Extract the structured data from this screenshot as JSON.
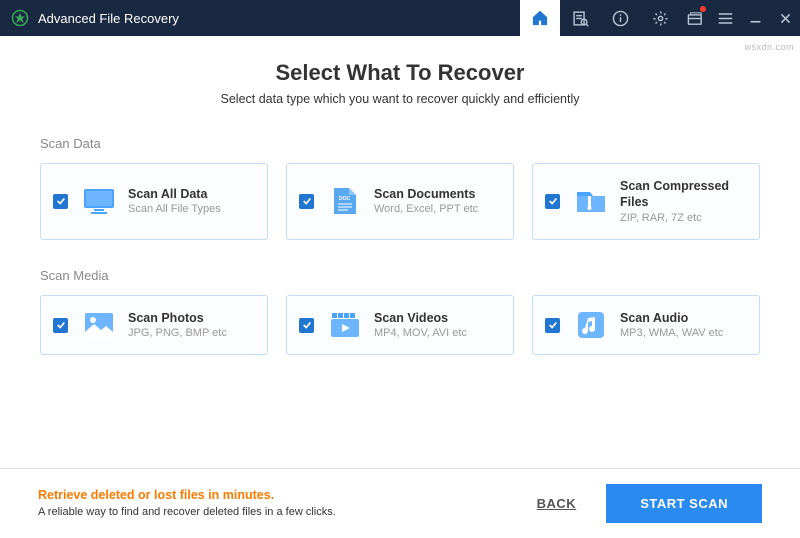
{
  "app": {
    "title": "Advanced File Recovery"
  },
  "header": {
    "title": "Select What To Recover",
    "subtitle": "Select data type which you want to recover quickly and efficiently"
  },
  "sections": {
    "data": {
      "label": "Scan Data",
      "cards": [
        {
          "title": "Scan All Data",
          "desc": "Scan All File Types"
        },
        {
          "title": "Scan Documents",
          "desc": "Word, Excel, PPT etc"
        },
        {
          "title": "Scan Compressed Files",
          "desc": "ZIP, RAR, 7Z etc"
        }
      ]
    },
    "media": {
      "label": "Scan Media",
      "cards": [
        {
          "title": "Scan Photos",
          "desc": "JPG, PNG, BMP etc"
        },
        {
          "title": "Scan Videos",
          "desc": "MP4, MOV, AVI etc"
        },
        {
          "title": "Scan Audio",
          "desc": "MP3, WMA, WAV etc"
        }
      ]
    }
  },
  "footer": {
    "title": "Retrieve deleted or lost files in minutes.",
    "desc": "A reliable way to find and recover deleted files in a few clicks.",
    "back": "BACK",
    "start": "START SCAN"
  },
  "watermark": "wsxdn.com"
}
